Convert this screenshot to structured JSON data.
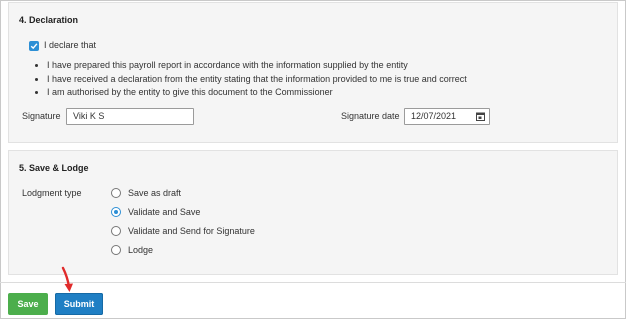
{
  "declaration": {
    "title": "4. Declaration",
    "checkbox_label": "I declare that",
    "checkbox_checked": true,
    "bullets": [
      "I have prepared this payroll report in accordance with the information supplied by the entity",
      "I have received a declaration from the entity stating that the information provided to me is true and correct",
      "I am authorised by the entity to give this document to the Commissioner"
    ],
    "signature_label": "Signature",
    "signature_value": "Viki K S",
    "signature_date_label": "Signature date",
    "signature_date_value": "12/07/2021"
  },
  "save_lodge": {
    "title": "5. Save & Lodge",
    "lodgment_type_label": "Lodgment type",
    "options": [
      {
        "label": "Save as draft",
        "selected": false
      },
      {
        "label": "Validate and Save",
        "selected": true
      },
      {
        "label": "Validate and Send for Signature",
        "selected": false
      },
      {
        "label": "Lodge",
        "selected": false
      }
    ]
  },
  "actions": {
    "save_label": "Save",
    "submit_label": "Submit"
  },
  "icons": {
    "checkbox": "check-icon",
    "date_picker": "calendar-icon",
    "annotation": "arrow-down-icon"
  },
  "colors": {
    "accent": "#2d8fd5",
    "save_button": "#4cae4c",
    "submit_button": "#1f7fc4",
    "annotation_arrow": "#e02b2b"
  }
}
